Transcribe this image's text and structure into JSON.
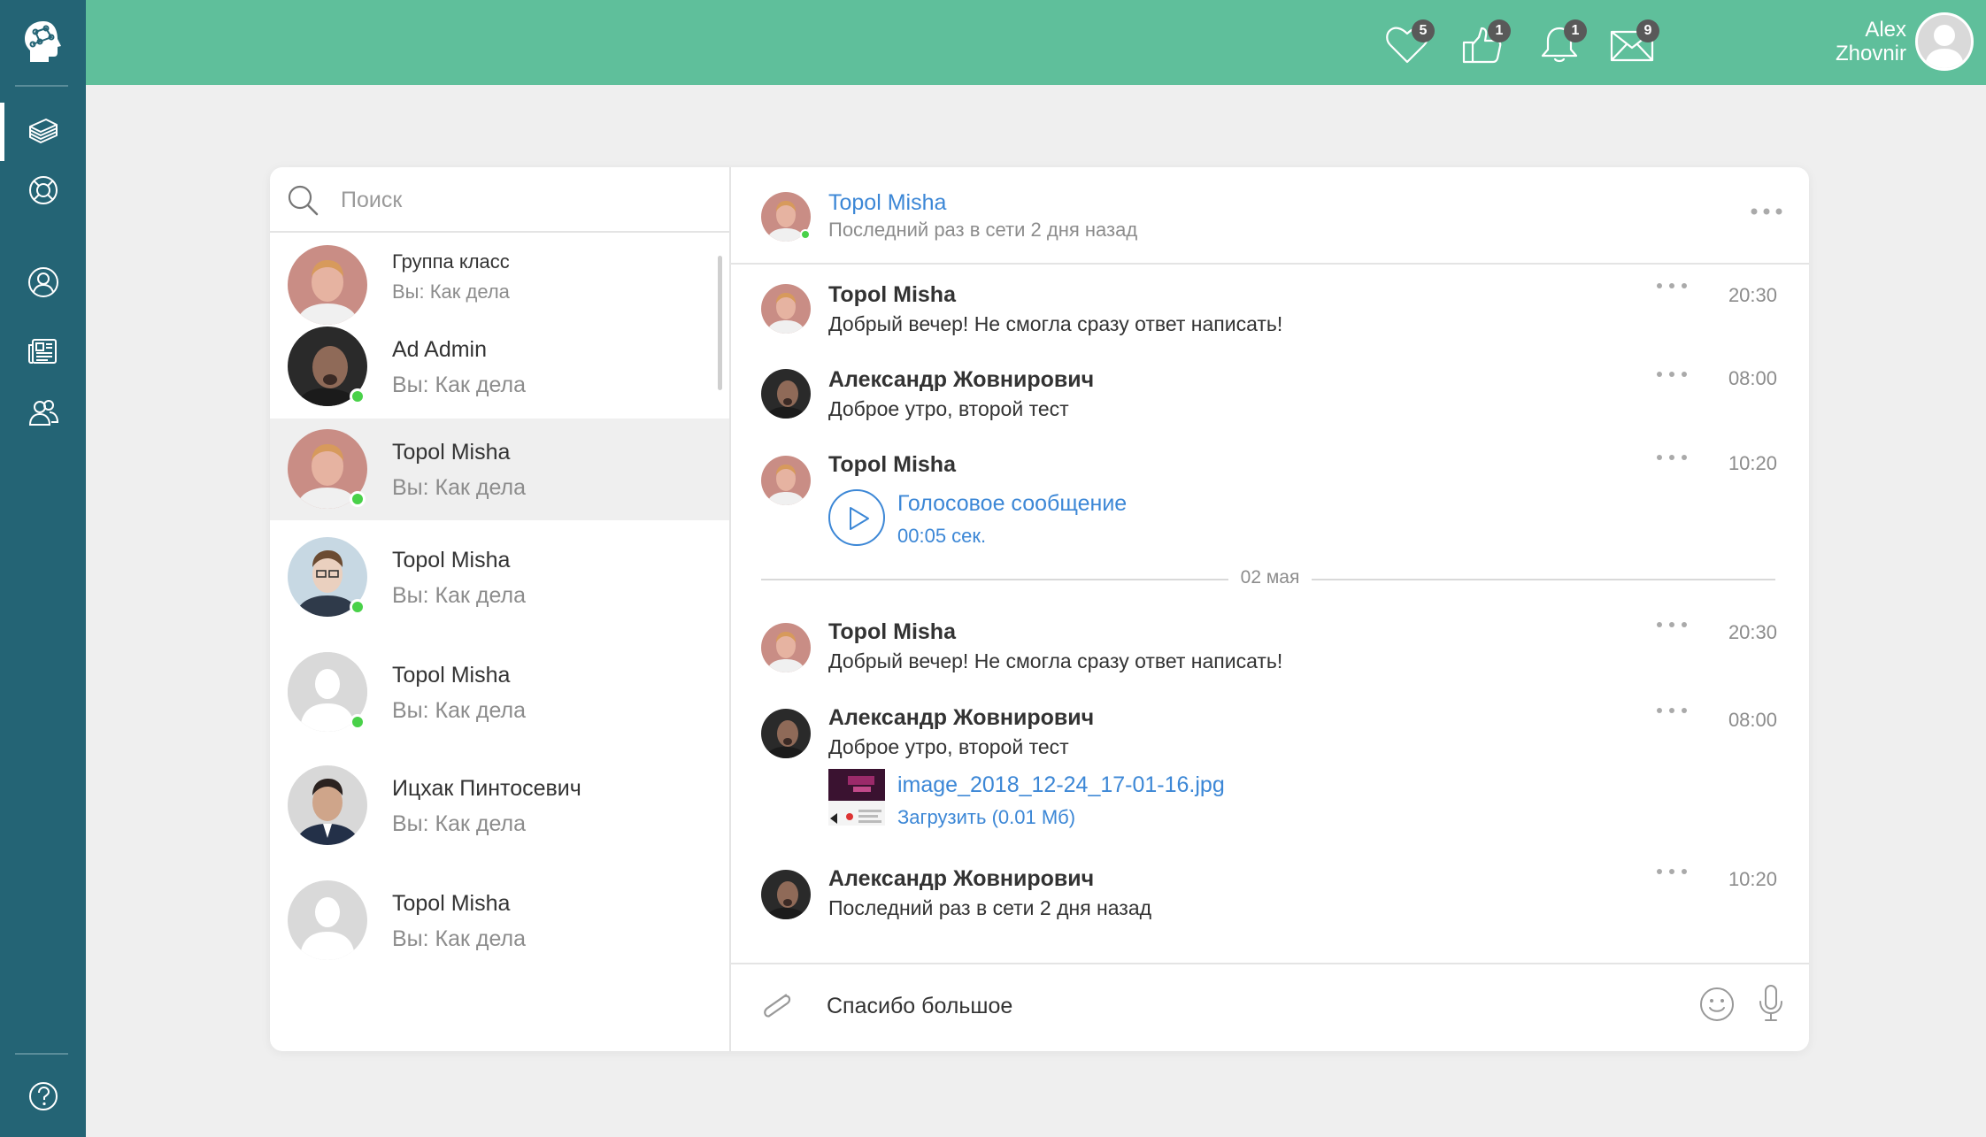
{
  "topbar": {
    "favorites_count": "5",
    "likes_count": "1",
    "notifications_count": "1",
    "messages_count": "9",
    "user_name_first": "Alex",
    "user_name_last": "Zhovnir"
  },
  "search": {
    "placeholder": "Поиск"
  },
  "contacts": [
    {
      "name": "Группа класс",
      "preview": "Вы: Как дела",
      "online": false
    },
    {
      "name": "Ad Admin",
      "preview": "Вы: Как дела",
      "online": true
    },
    {
      "name": "Topol Misha",
      "preview": "Вы: Как дела",
      "online": true,
      "active": true
    },
    {
      "name": "Topol Misha",
      "preview": "Вы: Как дела",
      "online": true
    },
    {
      "name": "Topol Misha",
      "preview": "Вы: Как дела",
      "online": true
    },
    {
      "name": "Ицхак Пинтосевич",
      "preview": "Вы: Как дела",
      "online": false
    },
    {
      "name": "Topol Misha",
      "preview": "Вы: Как дела",
      "online": false
    }
  ],
  "chat_header": {
    "name": "Topol Misha",
    "status": "Последний раз в сети 2 дня назад"
  },
  "messages": [
    {
      "author": "Topol Misha",
      "text": "Добрый вечер! Не смогла сразу ответ написать!",
      "time": "20:30"
    },
    {
      "author": "Александр Жовнирович",
      "text": "Доброе утро, второй тест",
      "time": "08:00"
    },
    {
      "author": "Topol Misha",
      "voice_label": "Голосовое сообщение",
      "voice_duration": "00:05 сек.",
      "time": "10:20"
    },
    {
      "author": "Topol Misha",
      "text": "Добрый вечер! Не смогла сразу ответ написать!",
      "time": "20:30"
    },
    {
      "author": "Александр Жовнирович",
      "text": "Доброе утро, второй тест",
      "file_name": "image_2018_12-24_17-01-16.jpg",
      "file_download": "Загрузить (0.01 Мб)",
      "time": "08:00"
    },
    {
      "author": "Александр Жовнирович",
      "text": "Последний раз в сети 2 дня назад",
      "time": "10:20"
    }
  ],
  "date_divider": "02 мая",
  "composer": {
    "value": "Спасибо большое"
  }
}
